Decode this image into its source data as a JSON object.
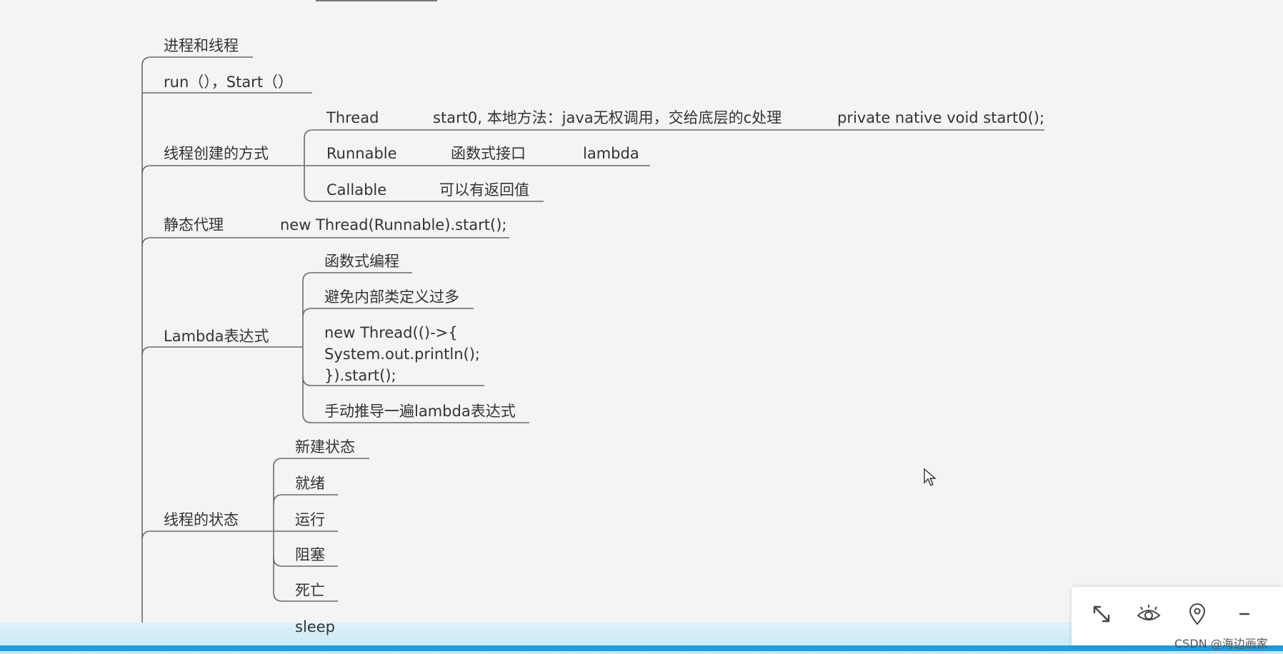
{
  "diagram": {
    "nodes": [
      {
        "id": "n1",
        "text": "进程和线程"
      },
      {
        "id": "n2",
        "text": "run（），Start（）"
      },
      {
        "id": "n3",
        "text": "线程创建的方式"
      },
      {
        "id": "n3a",
        "text": "Thread"
      },
      {
        "id": "n3a1",
        "text": "start0, 本地方法：java无权调用，交给底层的c处理"
      },
      {
        "id": "n3a2",
        "text": "private native void start0();"
      },
      {
        "id": "n3b",
        "text": "Runnable"
      },
      {
        "id": "n3b1",
        "text": "函数式接口"
      },
      {
        "id": "n3b2",
        "text": "lambda"
      },
      {
        "id": "n3c",
        "text": "Callable"
      },
      {
        "id": "n3c1",
        "text": "可以有返回值"
      },
      {
        "id": "n4",
        "text": "静态代理"
      },
      {
        "id": "n4a",
        "text": "new Thread(Runnable).start();"
      },
      {
        "id": "n5",
        "text": "Lambda表达式"
      },
      {
        "id": "n5a",
        "text": "函数式编程"
      },
      {
        "id": "n5b",
        "text": "避免内部类定义过多"
      },
      {
        "id": "n5c",
        "text": "new Thread(()->{\nSystem.out.println();\n}).start();"
      },
      {
        "id": "n5d",
        "text": "手动推导一遍lambda表达式"
      },
      {
        "id": "n6",
        "text": "线程的状态"
      },
      {
        "id": "n6a",
        "text": "新建状态"
      },
      {
        "id": "n6b",
        "text": "就绪"
      },
      {
        "id": "n6c",
        "text": "运行"
      },
      {
        "id": "n6d",
        "text": "阻塞"
      },
      {
        "id": "n6e",
        "text": "死亡"
      },
      {
        "id": "n7",
        "text": "sleep"
      }
    ],
    "edges": [
      [
        "root",
        "n1"
      ],
      [
        "root",
        "n2"
      ],
      [
        "root",
        "n3"
      ],
      [
        "root",
        "n4"
      ],
      [
        "root",
        "n5"
      ],
      [
        "root",
        "n6"
      ],
      [
        "root",
        "n7"
      ],
      [
        "n3",
        "n3a"
      ],
      [
        "n3a",
        "n3a1"
      ],
      [
        "n3a1",
        "n3a2"
      ],
      [
        "n3",
        "n3b"
      ],
      [
        "n3b",
        "n3b1"
      ],
      [
        "n3b1",
        "n3b2"
      ],
      [
        "n3",
        "n3c"
      ],
      [
        "n3c",
        "n3c1"
      ],
      [
        "n4",
        "n4a"
      ],
      [
        "n5",
        "n5a"
      ],
      [
        "n5",
        "n5b"
      ],
      [
        "n5",
        "n5c"
      ],
      [
        "n5",
        "n5d"
      ],
      [
        "n6",
        "n6a"
      ],
      [
        "n6",
        "n6b"
      ],
      [
        "n6",
        "n6c"
      ],
      [
        "n6",
        "n6d"
      ],
      [
        "n6",
        "n6e"
      ]
    ]
  },
  "toolbar": {
    "buttons": [
      {
        "icon": "expand-icon"
      },
      {
        "icon": "eye-icon"
      },
      {
        "icon": "location-pin-icon"
      },
      {
        "icon": "minus-icon"
      }
    ]
  },
  "watermark": "CSDN @海边画家"
}
